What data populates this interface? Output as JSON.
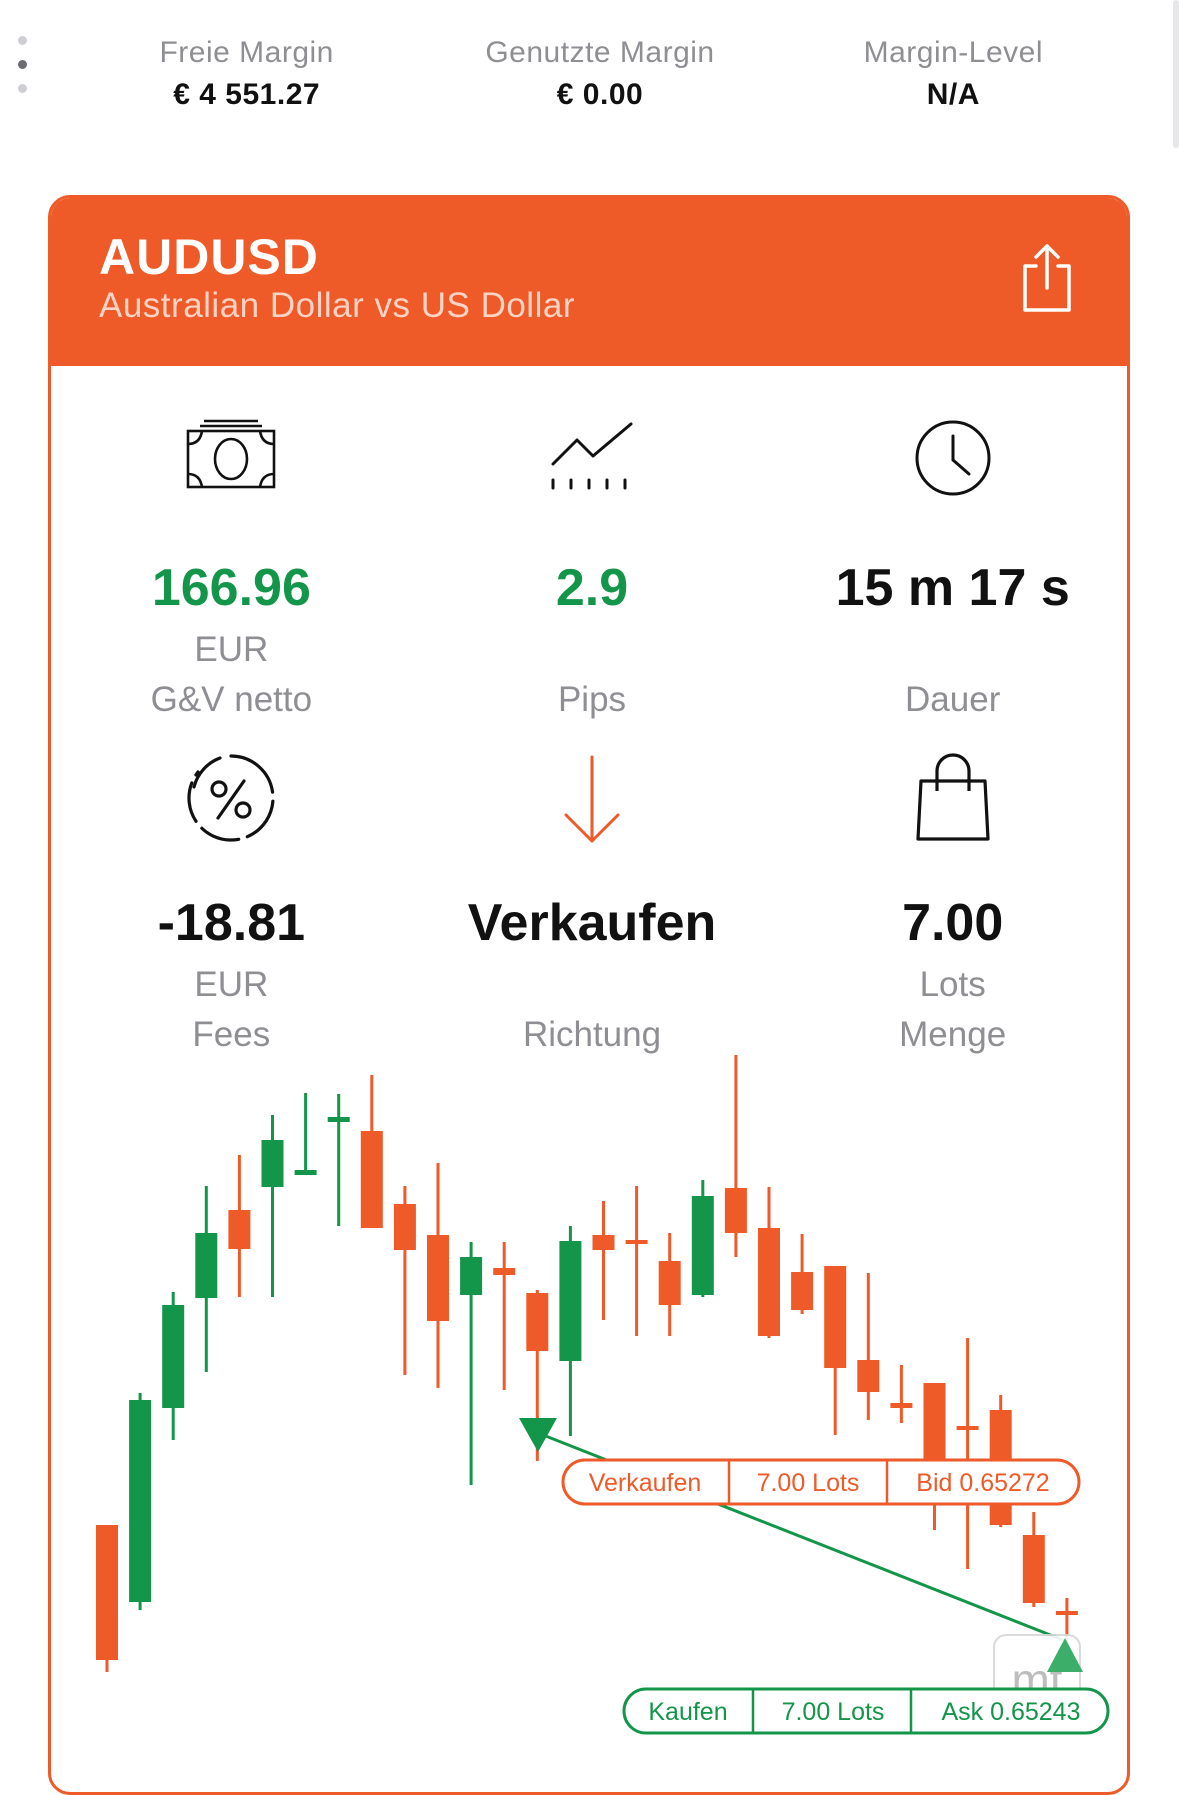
{
  "margins": [
    {
      "label": "Freie Margin",
      "value": "€ 4 551.27"
    },
    {
      "label": "Genutzte Margin",
      "value": "€ 0.00"
    },
    {
      "label": "Margin-Level",
      "value": "N/A"
    }
  ],
  "instrument": {
    "symbol": "AUDUSD",
    "description": "Australian Dollar vs US Dollar"
  },
  "stats": [
    {
      "icon": "banknote-icon",
      "value": "166.96",
      "unit": "EUR",
      "label": "G&V netto",
      "color": "#13954A"
    },
    {
      "icon": "trend-line-icon",
      "value": "2.9",
      "unit": "",
      "label": "Pips",
      "color": "#13954A"
    },
    {
      "icon": "clock-icon",
      "value": "15 m 17 s",
      "unit": "",
      "label": "Dauer",
      "color": "#111111"
    },
    {
      "icon": "percent-icon",
      "value": "-18.81",
      "unit": "EUR",
      "label": "Fees",
      "color": "#111111"
    },
    {
      "icon": "arrow-down-icon",
      "value": "Verkaufen",
      "unit": "",
      "label": "Richtung",
      "color": "#111111"
    },
    {
      "icon": "shopping-bag-icon",
      "value": "7.00",
      "unit": "Lots",
      "label": "Menge",
      "color": "#111111"
    }
  ],
  "colors": {
    "accent": "#EE5A28",
    "positive": "#13954A",
    "bearish_candle": "#EE5A28",
    "bullish_candle": "#13954A"
  },
  "trades": {
    "sell": {
      "direction": "Verkaufen",
      "lots": "7.00 Lots",
      "price": "Bid 0.65272"
    },
    "buy": {
      "direction": "Kaufen",
      "lots": "7.00 Lots",
      "price": "Ask 0.65243"
    }
  },
  "watermark": "mt",
  "chart_data": {
    "type": "candlestick",
    "candles": [
      {
        "o": 1525,
        "h": 1580,
        "l": 1672,
        "c": 1660
      },
      {
        "o": 1602,
        "h": 1393,
        "l": 1610,
        "c": 1400
      },
      {
        "o": 1408,
        "h": 1292,
        "l": 1440,
        "c": 1305
      },
      {
        "o": 1298,
        "h": 1186,
        "l": 1372,
        "c": 1233
      },
      {
        "o": 1210,
        "h": 1155,
        "l": 1297,
        "c": 1249
      },
      {
        "o": 1187,
        "h": 1115,
        "l": 1297,
        "c": 1140
      },
      {
        "o": 1175,
        "h": 1093,
        "l": 1170,
        "c": 1170
      },
      {
        "o": 1122,
        "h": 1094,
        "l": 1226,
        "c": 1117
      },
      {
        "o": 1131,
        "h": 1075,
        "l": 1228,
        "c": 1228
      },
      {
        "o": 1204,
        "h": 1186,
        "l": 1375,
        "c": 1250
      },
      {
        "o": 1235,
        "h": 1163,
        "l": 1388,
        "c": 1321
      },
      {
        "o": 1295,
        "h": 1242,
        "l": 1485,
        "c": 1257
      },
      {
        "o": 1268,
        "h": 1242,
        "l": 1390,
        "c": 1275
      },
      {
        "o": 1293,
        "h": 1290,
        "l": 1461,
        "c": 1351
      },
      {
        "o": 1361,
        "h": 1226,
        "l": 1436,
        "c": 1241
      },
      {
        "o": 1235,
        "h": 1201,
        "l": 1320,
        "c": 1250
      },
      {
        "o": 1240,
        "h": 1186,
        "l": 1336,
        "c": 1240
      },
      {
        "o": 1261,
        "h": 1233,
        "l": 1336,
        "c": 1305
      },
      {
        "o": 1295,
        "h": 1180,
        "l": 1297,
        "c": 1196
      },
      {
        "o": 1188,
        "h": 1055,
        "l": 1257,
        "c": 1233
      },
      {
        "o": 1228,
        "h": 1187,
        "l": 1338,
        "c": 1336
      },
      {
        "o": 1272,
        "h": 1234,
        "l": 1314,
        "c": 1310
      },
      {
        "o": 1266,
        "h": 1267,
        "l": 1435,
        "c": 1368
      },
      {
        "o": 1360,
        "h": 1273,
        "l": 1420,
        "c": 1392
      },
      {
        "o": 1403,
        "h": 1365,
        "l": 1423,
        "c": 1408
      },
      {
        "o": 1383,
        "h": 1383,
        "l": 1530,
        "c": 1489
      },
      {
        "o": 1426,
        "h": 1338,
        "l": 1569,
        "c": 1426
      },
      {
        "o": 1410,
        "h": 1395,
        "l": 1527,
        "c": 1525
      },
      {
        "o": 1535,
        "h": 1512,
        "l": 1607,
        "c": 1603
      },
      {
        "o": 1611,
        "h": 1598,
        "l": 1648,
        "c": 1611
      }
    ],
    "markers": [
      {
        "type": "sell",
        "label": "Verkaufen 7.00 Lots Bid 0.65272"
      },
      {
        "type": "buy",
        "label": "Kaufen 7.00 Lots Ask 0.65243"
      }
    ]
  }
}
